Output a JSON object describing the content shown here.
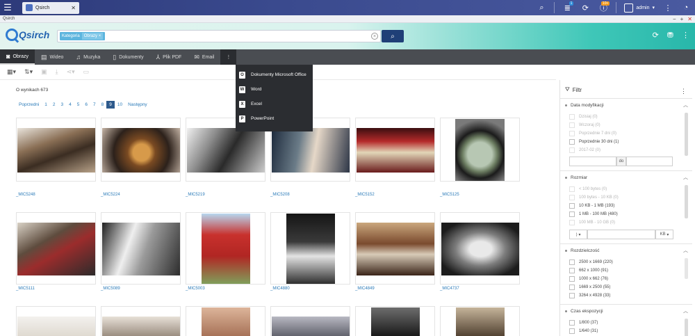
{
  "os_bar": {
    "app_tab_label": "Qsirch",
    "user_name": "admin",
    "badge_notifications": "1",
    "badge_info": "10+"
  },
  "window": {
    "title": "Qsirch"
  },
  "header": {
    "logo_text": "Qsirch",
    "chip_key": "Kategoria",
    "chip_value": "Obrazy"
  },
  "tabs": [
    {
      "label": "Obrazy"
    },
    {
      "label": "Wideo"
    },
    {
      "label": "Muzyka"
    },
    {
      "label": "Dokumenty"
    },
    {
      "label": "Plik PDF"
    },
    {
      "label": "Email"
    }
  ],
  "dropdown": [
    {
      "label": "Dokumenty Microsoft Office",
      "icon": "O"
    },
    {
      "label": "Word",
      "icon": "W"
    },
    {
      "label": "Excel",
      "icon": "X"
    },
    {
      "label": "PowerPoint",
      "icon": "P"
    }
  ],
  "results": {
    "summary": "O wynikach 673",
    "pager": {
      "prev": "Poprzedni",
      "pages": [
        "1",
        "2",
        "3",
        "4",
        "5",
        "6",
        "7",
        "8",
        "9",
        "10"
      ],
      "current": "9",
      "next": "Następny"
    },
    "captions_row1": [
      "_MIC5248",
      "_MIC5224",
      "_MIC5219",
      "_MIC5208",
      "_MIC5152",
      "_MIC5125"
    ],
    "captions_row2": [
      "_MIC5111",
      "_MIC5089",
      "_MIC5003",
      "_MIC4880",
      "_MIC4849",
      "_MIC4737"
    ]
  },
  "filter": {
    "title": "Filtr",
    "date": {
      "title": "Data modyfikacji",
      "options": [
        "Dzisiaj (0)",
        "Wczoraj (0)",
        "Poprzednie 7 dni (0)",
        "Poprzednie 30 dni (1)",
        "2017-02 (0)"
      ],
      "to_label": "do"
    },
    "size": {
      "title": "Rozmiar",
      "options": [
        "< 100 bytes (0)",
        "100 bytes - 10 KB (0)",
        "10 KB - 1 MB (193)",
        "1 MB - 100 MB (480)",
        "100 MB - 10 GB (0)"
      ],
      "unit": "KB"
    },
    "resolution": {
      "title": "Rozdzielczość",
      "options": [
        "2500 x 1669 (220)",
        "662 x 1000 (91)",
        "1000 x 662 (76)",
        "1669 x 2500 (55)",
        "3264 x 4928 (33)"
      ]
    },
    "exposure": {
      "title": "Czas ekspozycji",
      "options": [
        "1/800 (37)",
        "1/640 (31)"
      ]
    }
  }
}
